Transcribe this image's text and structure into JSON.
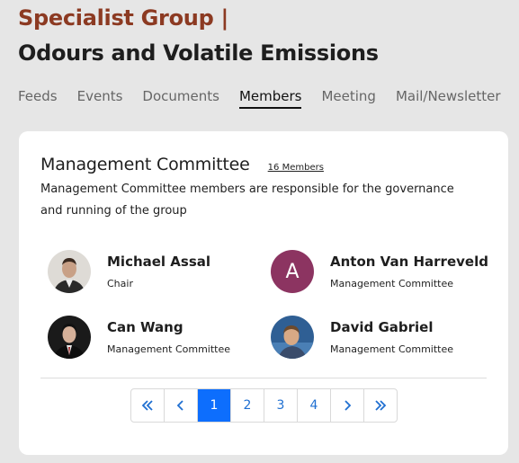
{
  "group": {
    "kicker": "Specialist Group |",
    "title": "Odours and Volatile Emissions"
  },
  "tabs": [
    {
      "label": "Feeds"
    },
    {
      "label": "Events"
    },
    {
      "label": "Documents"
    },
    {
      "label": "Members",
      "active": true
    },
    {
      "label": "Meeting"
    },
    {
      "label": "Mail/Newsletter"
    }
  ],
  "committee": {
    "title": "Management Committee",
    "member_count": "16 Members",
    "description": "Management Committee members are responsible for the governance and running of the group"
  },
  "members": [
    {
      "name": "Michael Assal",
      "role": "Chair",
      "avatar": "photo"
    },
    {
      "name": "Anton Van Harreveld",
      "role": "Management Committee",
      "avatar": "initial",
      "initial": "A"
    },
    {
      "name": "Can Wang",
      "role": "Management Committee",
      "avatar": "photo"
    },
    {
      "name": "David Gabriel",
      "role": "Management Committee",
      "avatar": "photo"
    }
  ],
  "pagination": {
    "first_icon": "double-chevron-left-icon",
    "prev_icon": "chevron-left-icon",
    "pages": [
      "1",
      "2",
      "3",
      "4"
    ],
    "current_page": "1",
    "next_icon": "chevron-right-icon",
    "last_icon": "double-chevron-right-icon"
  },
  "colors": {
    "kicker": "#8c3a22",
    "accent": "#0d6efd",
    "avatar_initial_bg": "#8c3461"
  }
}
